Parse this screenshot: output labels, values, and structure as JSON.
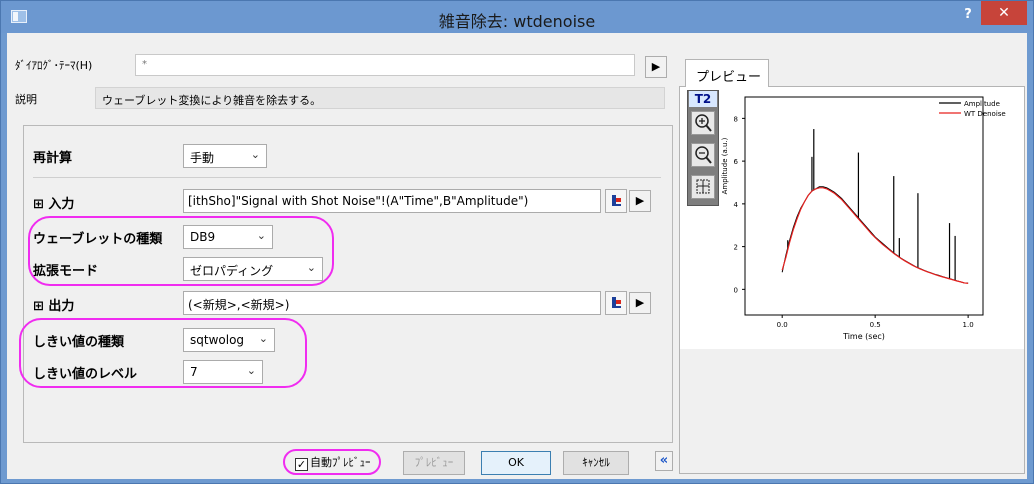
{
  "window": {
    "title": "雑音除去: wtdenoise",
    "help_label": "?",
    "close_label": "✕"
  },
  "top": {
    "theme_label": "ﾀﾞｲｱﾛｸﾞ･ﾃｰﾏ(H)",
    "theme_value": "*",
    "desc_label": "説明",
    "desc_value": "ウェーブレット変換により雑音を除去する。"
  },
  "form": {
    "recalc_label": "再計算",
    "recalc_value": "手動",
    "input_label": "⊞ 入力",
    "input_value": "[ithSho]\"Signal with Shot Noise\"!(A\"Time\",B\"Amplitude\")",
    "wavelet_label": "ウェーブレットの種類",
    "wavelet_value": "DB9",
    "extmode_label": "拡張モード",
    "extmode_value": "ゼロパディング",
    "output_label": "⊞ 出力",
    "output_value": "(<新規>,<新規>)",
    "thtype_label": "しきい値の種類",
    "thtype_value": "sqtwolog",
    "thlevel_label": "しきい値のレベル",
    "thlevel_value": "7"
  },
  "buttons": {
    "auto_preview_label": "自動ﾌﾟﾚﾋﾞｭｰ",
    "auto_preview_checked": true,
    "preview_label": "ﾌﾟﾚﾋﾞｭｰ",
    "ok_label": "OK",
    "cancel_label": "ｷｬﾝｾﾙ",
    "collapse_label": "«"
  },
  "preview": {
    "tab_label": "プレビュー",
    "toolbar_label": "T2"
  },
  "chart_data": {
    "type": "line",
    "xlabel": "Time (sec)",
    "ylabel": "Amplitude (a.u.)",
    "xlim": [
      -0.2,
      1.08
    ],
    "ylim": [
      -1.2,
      9.0
    ],
    "x_ticks": [
      0.0,
      0.5,
      1.0
    ],
    "x_tick_labels": [
      "0.0",
      "0.5",
      "1.0"
    ],
    "y_ticks": [
      0,
      2,
      4,
      6,
      8
    ],
    "y_tick_labels": [
      "0",
      "2",
      "4",
      "6",
      "8"
    ],
    "legend_position": "top-right",
    "series": [
      {
        "name": "Amplitude",
        "color": "#000000",
        "x": [
          0.0,
          0.02,
          0.04,
          0.06,
          0.08,
          0.1,
          0.12,
          0.14,
          0.16,
          0.18,
          0.2,
          0.22,
          0.24,
          0.26,
          0.28,
          0.3,
          0.32,
          0.34,
          0.36,
          0.38,
          0.4,
          0.42,
          0.44,
          0.46,
          0.48,
          0.5,
          0.52,
          0.54,
          0.56,
          0.58,
          0.6,
          0.62,
          0.64,
          0.66,
          0.68,
          0.7,
          0.72,
          0.74,
          0.76,
          0.78,
          0.8,
          0.82,
          0.84,
          0.86,
          0.88,
          0.9,
          0.92,
          0.94,
          0.96,
          0.98,
          1.0
        ],
        "y": [
          0.8,
          1.6,
          2.3,
          2.9,
          3.4,
          3.8,
          4.1,
          4.4,
          4.6,
          4.7,
          4.8,
          4.8,
          4.75,
          4.65,
          4.55,
          4.4,
          4.25,
          4.05,
          3.85,
          3.65,
          3.45,
          3.25,
          3.05,
          2.85,
          2.65,
          2.45,
          2.3,
          2.15,
          2.0,
          1.85,
          1.7,
          1.58,
          1.45,
          1.35,
          1.25,
          1.15,
          1.05,
          0.98,
          0.9,
          0.83,
          0.77,
          0.71,
          0.66,
          0.6,
          0.55,
          0.5,
          0.45,
          0.4,
          0.35,
          0.3,
          0.3
        ],
        "spikes": [
          {
            "x": 0.03,
            "y": 2.3
          },
          {
            "x": 0.16,
            "y": 6.2
          },
          {
            "x": 0.17,
            "y": 7.5
          },
          {
            "x": 0.41,
            "y": 6.4
          },
          {
            "x": 0.6,
            "y": 5.3
          },
          {
            "x": 0.63,
            "y": 2.4
          },
          {
            "x": 0.73,
            "y": 4.5
          },
          {
            "x": 0.9,
            "y": 3.1
          },
          {
            "x": 0.93,
            "y": 2.5
          }
        ]
      },
      {
        "name": "WT Denoise",
        "color": "#e8211f",
        "x": [
          0.0,
          0.02,
          0.04,
          0.06,
          0.08,
          0.1,
          0.12,
          0.14,
          0.16,
          0.18,
          0.2,
          0.22,
          0.24,
          0.26,
          0.28,
          0.3,
          0.32,
          0.34,
          0.36,
          0.38,
          0.4,
          0.42,
          0.44,
          0.46,
          0.48,
          0.5,
          0.52,
          0.54,
          0.56,
          0.58,
          0.6,
          0.62,
          0.64,
          0.66,
          0.68,
          0.7,
          0.72,
          0.74,
          0.76,
          0.78,
          0.8,
          0.82,
          0.84,
          0.86,
          0.88,
          0.9,
          0.92,
          0.94,
          0.96,
          0.98,
          1.0
        ],
        "y": [
          0.9,
          1.5,
          2.2,
          2.8,
          3.3,
          3.75,
          4.1,
          4.4,
          4.6,
          4.7,
          4.75,
          4.75,
          4.7,
          4.6,
          4.5,
          4.35,
          4.2,
          4.0,
          3.8,
          3.6,
          3.4,
          3.2,
          3.0,
          2.8,
          2.6,
          2.42,
          2.26,
          2.1,
          1.96,
          1.82,
          1.68,
          1.56,
          1.44,
          1.33,
          1.23,
          1.13,
          1.04,
          0.96,
          0.89,
          0.82,
          0.76,
          0.7,
          0.64,
          0.59,
          0.54,
          0.49,
          0.44,
          0.39,
          0.35,
          0.3,
          0.28
        ]
      }
    ]
  }
}
